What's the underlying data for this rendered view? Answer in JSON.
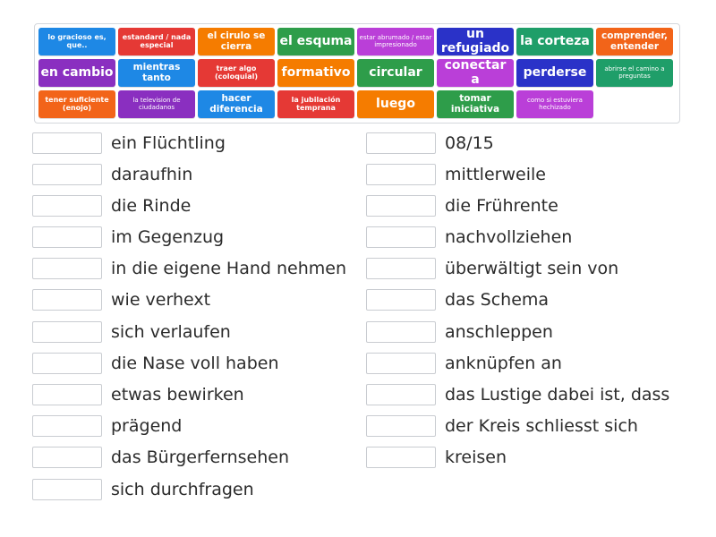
{
  "colors": {
    "blue": "#1e88e5",
    "red": "#e53935",
    "orange": "#f57c00",
    "green": "#2e9d4a",
    "violet": "#ba3fd8",
    "purple": "#8a2fc0",
    "navy": "#2a32c8",
    "teal": "#1f9e69",
    "deeporange": "#f26419"
  },
  "tiles": [
    {
      "text": "lo gracioso es, que..",
      "color": "blue"
    },
    {
      "text": "estandard / nada especial",
      "color": "red"
    },
    {
      "text": "el cirulo se cierra",
      "color": "orange"
    },
    {
      "text": "el esquma",
      "color": "green"
    },
    {
      "text": "estar abrumado / estar impresionado",
      "color": "violet"
    },
    {
      "text": "un refugiado",
      "color": "navy"
    },
    {
      "text": "la corteza",
      "color": "teal"
    },
    {
      "text": "comprender, entender",
      "color": "deeporange"
    },
    {
      "text": "en cambio",
      "color": "purple"
    },
    {
      "text": "mientras tanto",
      "color": "blue"
    },
    {
      "text": "traer algo (coloquial)",
      "color": "red"
    },
    {
      "text": "formativo",
      "color": "orange"
    },
    {
      "text": "circular",
      "color": "green"
    },
    {
      "text": "conectar a",
      "color": "violet"
    },
    {
      "text": "perderse",
      "color": "navy"
    },
    {
      "text": "abrirse el camino a preguntas",
      "color": "teal"
    },
    {
      "text": "tener suficiente (enojo)",
      "color": "deeporange"
    },
    {
      "text": "la television de ciudadanos",
      "color": "purple"
    },
    {
      "text": "hacer diferencia",
      "color": "blue"
    },
    {
      "text": "la jubilación temprana",
      "color": "red"
    },
    {
      "text": "luego",
      "color": "orange"
    },
    {
      "text": "tomar iniciativa",
      "color": "green"
    },
    {
      "text": "como si estuviera hechizado",
      "color": "violet"
    }
  ],
  "targets_left": [
    "ein Flüchtling",
    "daraufhin",
    "die Rinde",
    "im Gegenzug",
    "in die eigene Hand nehmen",
    "wie verhext",
    "sich verlaufen",
    "die Nase voll haben",
    "etwas bewirken",
    "prägend",
    "das Bürgerfernsehen",
    "sich durchfragen"
  ],
  "targets_right": [
    "08/15",
    "mittlerweile",
    "die Frührente",
    "nachvollziehen",
    "überwältigt sein von",
    "das Schema",
    "anschleppen",
    "anknüpfen an",
    "das Lustige dabei ist, dass",
    "der Kreis schliesst sich",
    "kreisen"
  ]
}
